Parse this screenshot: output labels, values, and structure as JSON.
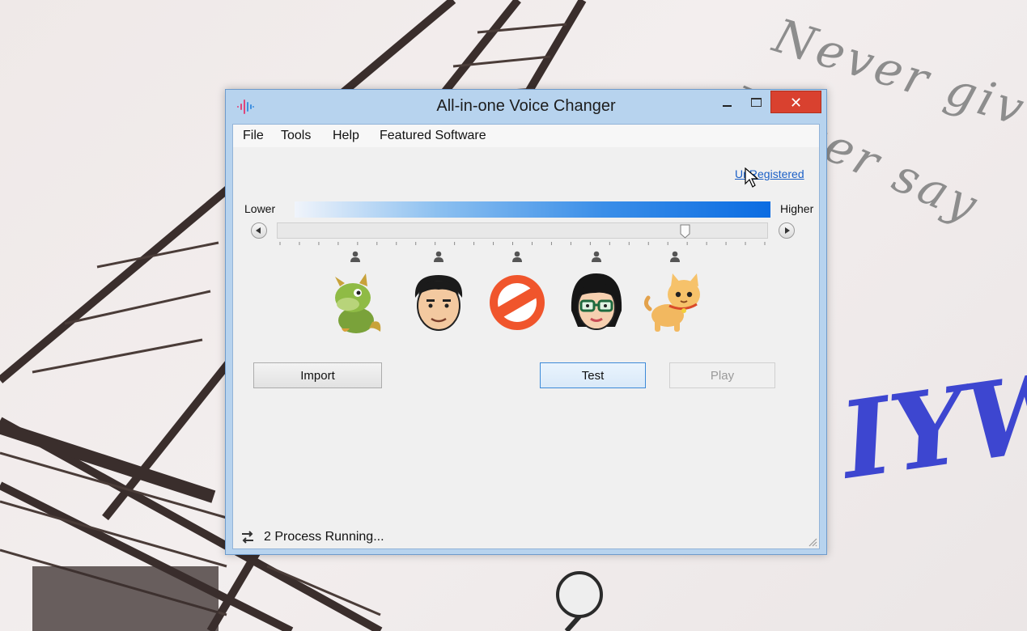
{
  "window": {
    "title": "All-in-one Voice Changer",
    "close_glyph": "✕"
  },
  "menu": {
    "file": "File",
    "tools": "Tools",
    "help": "Help",
    "featured": "Featured Software"
  },
  "registration": {
    "link_text": "UnRegistered"
  },
  "pitch": {
    "lower_label": "Lower",
    "higher_label": "Higher",
    "slider_value": 0.83,
    "tick_count": 26
  },
  "voices": [
    {
      "name": "dragon",
      "icon": "dragon-icon",
      "preset_position": 0.16
    },
    {
      "name": "man",
      "icon": "man-face-icon",
      "preset_position": 0.33
    },
    {
      "name": "none",
      "icon": "no-effect-icon",
      "preset_position": 0.49
    },
    {
      "name": "woman",
      "icon": "woman-face-icon",
      "preset_position": 0.65
    },
    {
      "name": "cat",
      "icon": "cat-icon",
      "preset_position": 0.81
    }
  ],
  "buttons": {
    "import": "Import",
    "test": "Test",
    "play": "Play"
  },
  "status": {
    "text": "2 Process Running..."
  },
  "wallpaper_text": {
    "line1": "Never giv",
    "line2": "Never say",
    "big": "IYW"
  },
  "colors": {
    "accent": "#0b6ce2",
    "close": "#d9412f",
    "link": "#1a5fc6"
  }
}
